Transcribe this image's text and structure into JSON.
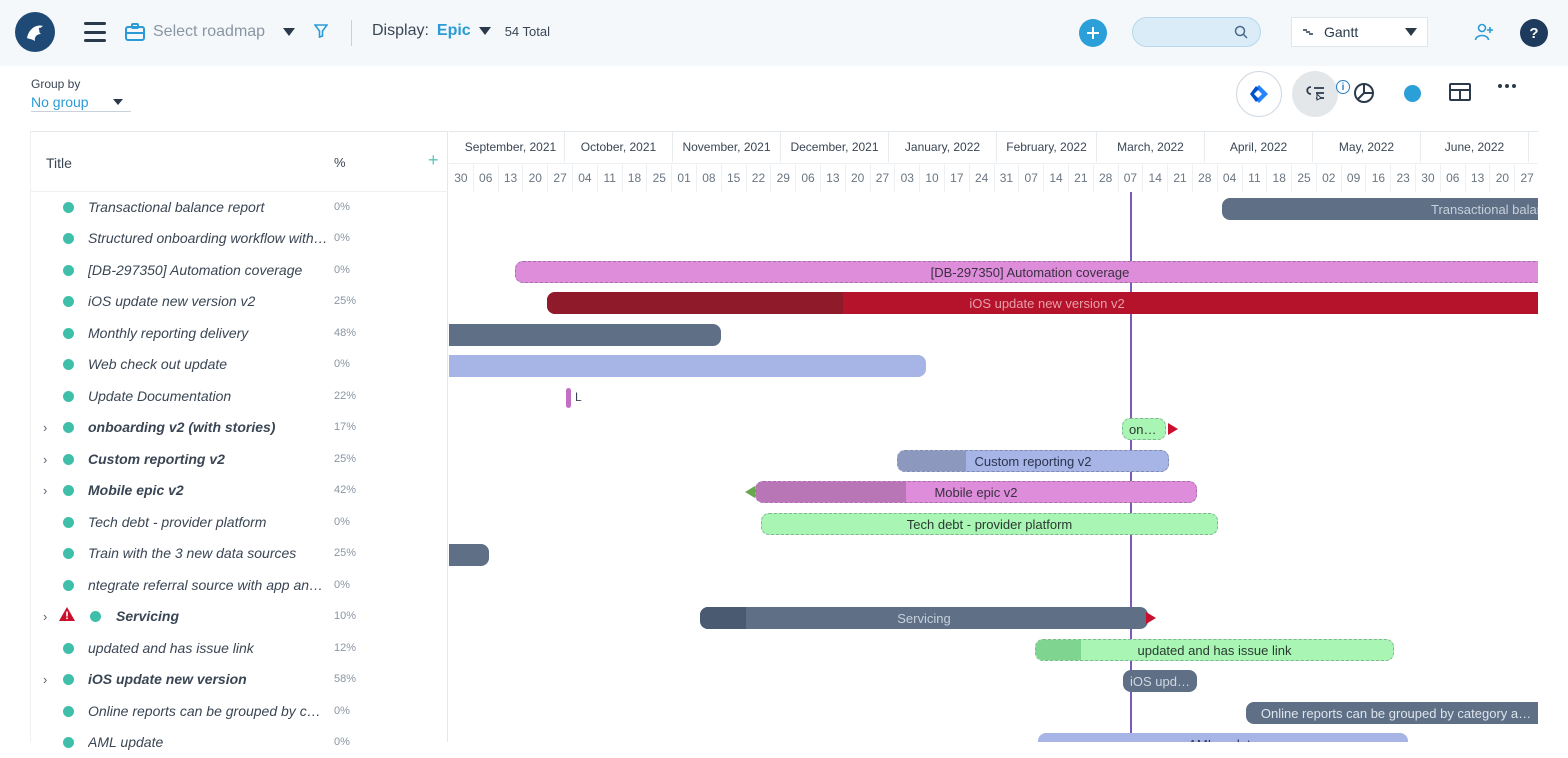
{
  "toolbar": {
    "roadmap_placeholder": "Select roadmap",
    "display_label": "Display:",
    "display_value": "Epic",
    "total": "54 Total",
    "view": "Gantt",
    "help": "?"
  },
  "groupby": {
    "label": "Group by",
    "value": "No group"
  },
  "tools": {
    "info": "i"
  },
  "list": {
    "header_title": "Title",
    "header_pct": "%",
    "add": "+",
    "rows": [
      {
        "title": "Transactional balance report",
        "pct": "0%"
      },
      {
        "title": "Structured onboarding workflow with …",
        "pct": "0%"
      },
      {
        "title": "[DB-297350] Automation coverage",
        "pct": "0%"
      },
      {
        "title": "iOS update new version v2",
        "pct": "25%"
      },
      {
        "title": "Monthly reporting delivery",
        "pct": "48%"
      },
      {
        "title": "Web check out update",
        "pct": "0%"
      },
      {
        "title": "Update Documentation",
        "pct": "22%"
      },
      {
        "title": "onboarding v2 (with stories)",
        "pct": "17%"
      },
      {
        "title": "Custom reporting v2",
        "pct": "25%"
      },
      {
        "title": "Mobile epic v2",
        "pct": "42%"
      },
      {
        "title": "Tech debt - provider platform",
        "pct": "0%"
      },
      {
        "title": "Train with the 3 new data sources",
        "pct": "25%"
      },
      {
        "title": "ntegrate referral source with app anal…",
        "pct": "0%"
      },
      {
        "title": "Servicing",
        "pct": "10%"
      },
      {
        "title": "updated and has issue link",
        "pct": "12%"
      },
      {
        "title": "iOS update new version",
        "pct": "58%"
      },
      {
        "title": "Online reports can be grouped by cat…",
        "pct": "0%"
      },
      {
        "title": "AML update",
        "pct": "0%"
      }
    ]
  },
  "timeline": {
    "months": [
      "September, 2021",
      "October, 2021",
      "November, 2021",
      "December, 2021",
      "January, 2022",
      "February, 2022",
      "March, 2022",
      "April, 2022",
      "May, 2022",
      "June, 2022"
    ],
    "weeks": [
      "30",
      "06",
      "13",
      "20",
      "27",
      "04",
      "11",
      "18",
      "25",
      "01",
      "08",
      "15",
      "22",
      "29",
      "06",
      "13",
      "20",
      "27",
      "03",
      "10",
      "17",
      "24",
      "31",
      "07",
      "14",
      "21",
      "28",
      "07",
      "14",
      "21",
      "28",
      "04",
      "11",
      "18",
      "25",
      "02",
      "09",
      "16",
      "23",
      "30",
      "06",
      "13",
      "20",
      "27"
    ]
  },
  "bars": {
    "b0": "Transactional balan",
    "b2": "[DB-297350] Automation coverage",
    "b3": "iOS update new version v2",
    "b6": "L",
    "b7": "on…",
    "b8": "Custom reporting v2",
    "b9": "Mobile epic v2",
    "b10": "Tech debt - provider platform",
    "b13": "Servicing",
    "b14": "updated and has issue link",
    "b15": "iOS upd…",
    "b16": "Online reports can be grouped by category a…",
    "b17": "AML update"
  },
  "colors": {
    "accent": "#2a9fd8",
    "status_dot": "#3fbfaa",
    "today_line": "#7b5ab8",
    "slate": "#5e6f86",
    "pink": "#de8ddb",
    "red": "#b5122b",
    "periwinkle": "#a7b5e6",
    "mint": "#a8f5b4"
  }
}
